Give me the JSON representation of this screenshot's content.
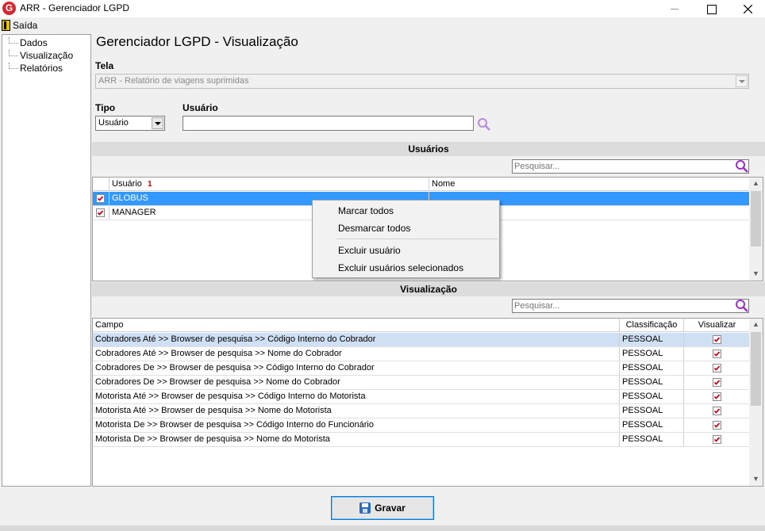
{
  "window": {
    "title": "ARR - Gerenciador LGPD",
    "app_icon_letter": "G"
  },
  "menu": {
    "exit_label": "Saída"
  },
  "sidebar": {
    "items": [
      "Dados",
      "Visualização",
      "Relatórios"
    ]
  },
  "page": {
    "title": "Gerenciador LGPD - Visualização"
  },
  "form": {
    "tela_label": "Tela",
    "tela_value": "ARR - Relatório de viagens suprimidas",
    "tipo_label": "Tipo",
    "tipo_value": "Usuário",
    "usuario_label": "Usuário",
    "usuario_value": ""
  },
  "users_section": {
    "header": "Usuários",
    "search_placeholder": "Pesquisar...",
    "columns": [
      "Usuário",
      "Nome"
    ],
    "sort_indicator": "1",
    "rows": [
      {
        "usuario": "GLOBUS",
        "nome": "",
        "checked": true,
        "selected": true
      },
      {
        "usuario": "MANAGER",
        "nome": "",
        "checked": true,
        "selected": false
      }
    ]
  },
  "context_menu": {
    "items": [
      "Marcar todos",
      "Desmarcar todos",
      "Excluir usuário",
      "Excluir usuários selecionados"
    ]
  },
  "view_section": {
    "header": "Visualização",
    "search_placeholder": "Pesquisar...",
    "columns": [
      "Campo",
      "Classificação",
      "Visualizar"
    ],
    "rows": [
      {
        "campo": "Cobradores Até >> Browser de pesquisa >> Código Interno do Cobrador",
        "classificacao": "PESSOAL",
        "visualizar": true
      },
      {
        "campo": "Cobradores Até >> Browser de pesquisa >> Nome do Cobrador",
        "classificacao": "PESSOAL",
        "visualizar": true
      },
      {
        "campo": "Cobradores De >> Browser de pesquisa >> Código Interno do Cobrador",
        "classificacao": "PESSOAL",
        "visualizar": true
      },
      {
        "campo": "Cobradores De >> Browser de pesquisa >> Nome do Cobrador",
        "classificacao": "PESSOAL",
        "visualizar": true
      },
      {
        "campo": "Motorista Até >> Browser de pesquisa >> Código Interno do Motorista",
        "classificacao": "PESSOAL",
        "visualizar": true
      },
      {
        "campo": "Motorista Até >> Browser de pesquisa >> Nome do Motorista",
        "classificacao": "PESSOAL",
        "visualizar": true
      },
      {
        "campo": "Motorista De >> Browser de pesquisa >> Código Interno do Funcionário",
        "classificacao": "PESSOAL",
        "visualizar": true
      },
      {
        "campo": "Motorista De >> Browser de pesquisa >> Nome do Motorista",
        "classificacao": "PESSOAL",
        "visualizar": true
      }
    ]
  },
  "footer": {
    "save_label": "Gravar"
  },
  "colors": {
    "accent": "#3399ff",
    "check": "#d0021b",
    "search_icon": "#9b2fc9"
  }
}
